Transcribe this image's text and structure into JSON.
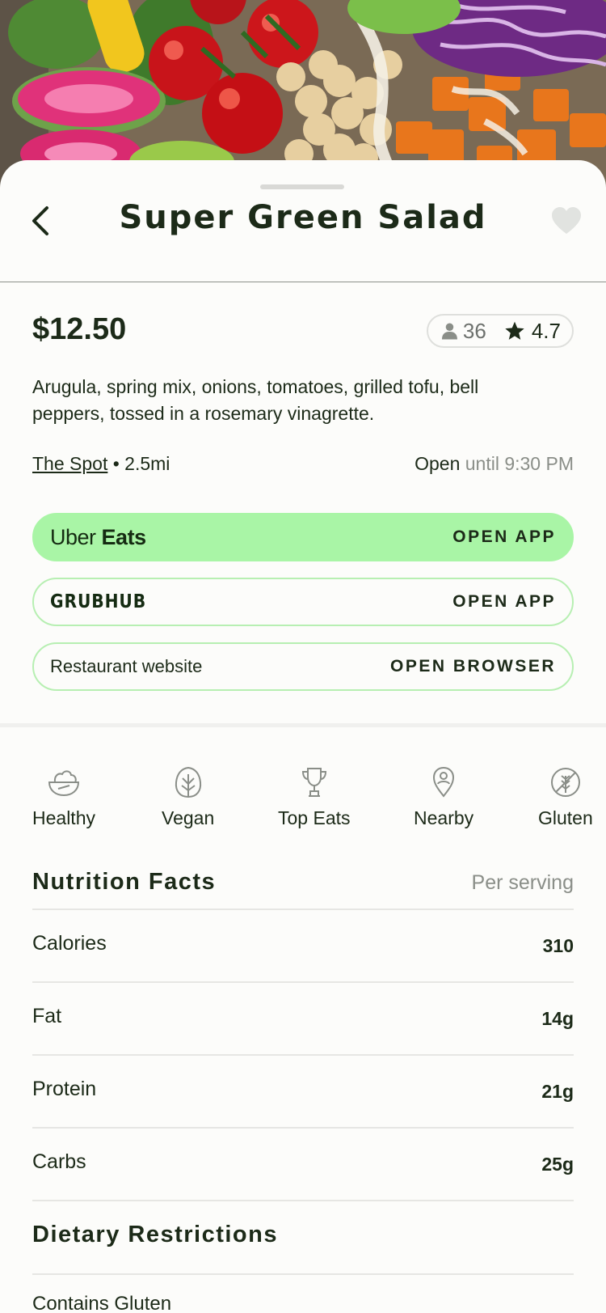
{
  "item": {
    "title": "Super Green Salad",
    "price": "$12.50",
    "review_count": "36",
    "rating": "4.7",
    "description": "Arugula, spring mix, onions, tomatoes, grilled tofu, bell peppers, tossed in a rosemary vinagrette."
  },
  "location": {
    "restaurant": "The Spot",
    "distance": "• 2.5mi",
    "status": "Open",
    "hours": "until 9:30 PM"
  },
  "actions": {
    "uber_brand_light": "Uber",
    "uber_brand_bold": "Eats",
    "uber_cta": "OPEN APP",
    "grubhub_brand": "GRUBHUB",
    "grubhub_cta": "OPEN APP",
    "website_label": "Restaurant website",
    "website_cta": "OPEN BROWSER"
  },
  "tags": [
    {
      "label": "Healthy",
      "icon": "salad-bowl-icon"
    },
    {
      "label": "Vegan",
      "icon": "lettuce-icon"
    },
    {
      "label": "Top Eats",
      "icon": "trophy-icon"
    },
    {
      "label": "Nearby",
      "icon": "map-pin-icon"
    },
    {
      "label": "Gluten",
      "icon": "wheat-icon"
    }
  ],
  "nutrition": {
    "title": "Nutrition Facts",
    "subtitle": "Per serving",
    "rows": [
      {
        "label": "Calories",
        "value": "310"
      },
      {
        "label": "Fat",
        "value": "14g"
      },
      {
        "label": "Protein",
        "value": "21g"
      },
      {
        "label": "Carbs",
        "value": "25g"
      }
    ]
  },
  "dietary": {
    "title": "Dietary Restrictions",
    "first_item": "Contains Gluten"
  },
  "colors": {
    "accent_green": "#a9f5a6",
    "outline_green": "#b7efb2",
    "text_dark": "#1c2a18",
    "muted": "#8a8e88"
  }
}
